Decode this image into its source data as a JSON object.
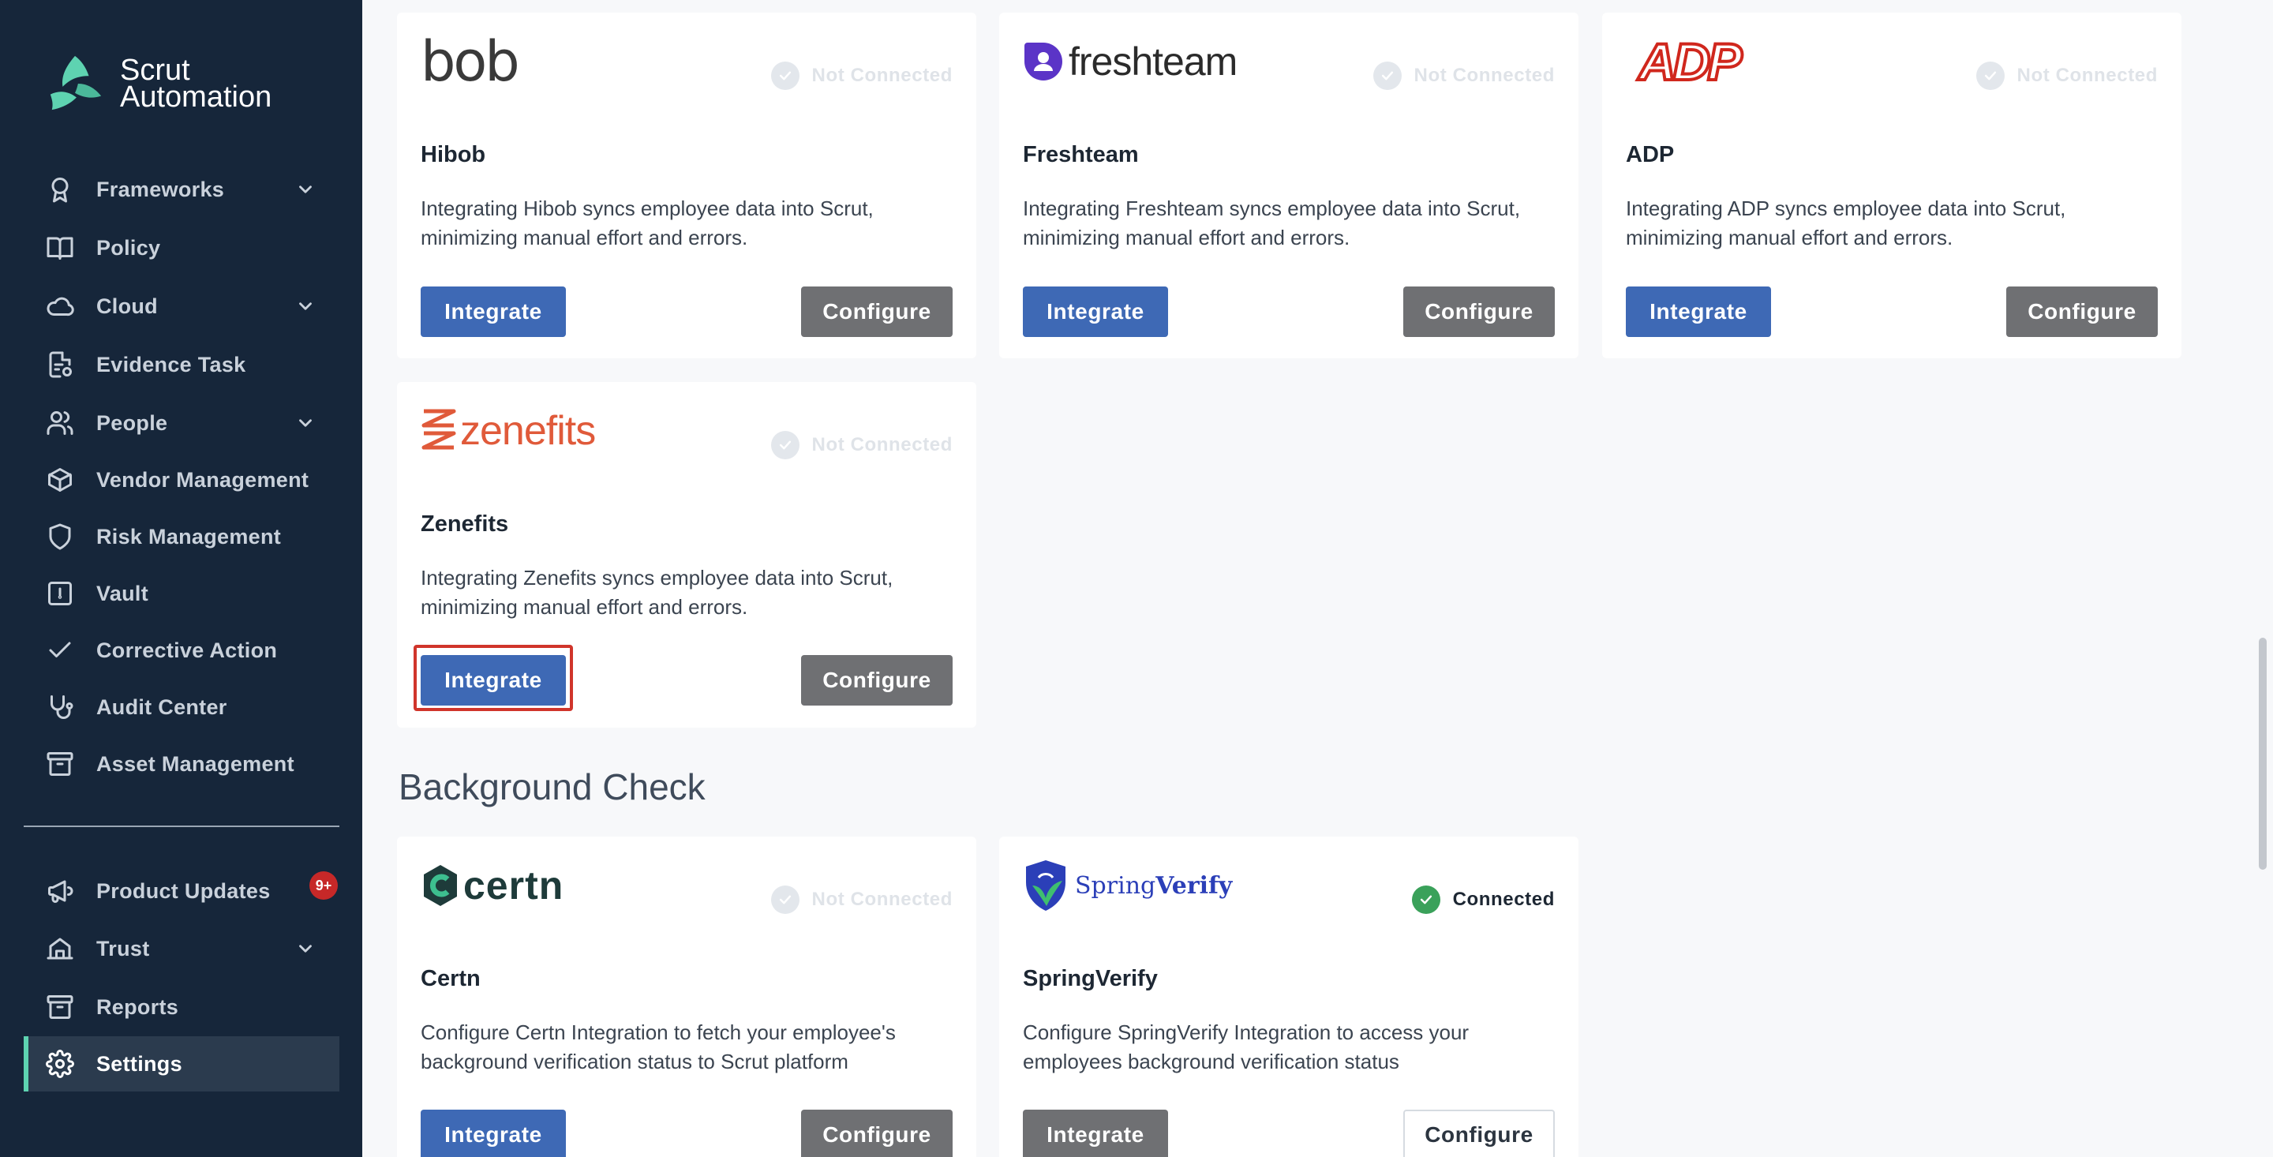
{
  "brand": {
    "line1": "Scrut",
    "line2": "Automation"
  },
  "sidebar": {
    "items": [
      {
        "label": "Frameworks",
        "icon": "award-icon",
        "chevron": true
      },
      {
        "label": "Policy",
        "icon": "book-icon",
        "chevron": false
      },
      {
        "label": "Cloud",
        "icon": "cloud-icon",
        "chevron": true
      },
      {
        "label": "Evidence Task",
        "icon": "file-check-icon",
        "chevron": false
      },
      {
        "label": "People",
        "icon": "users-icon",
        "chevron": true
      },
      {
        "label": "Vendor Management",
        "icon": "box-icon",
        "chevron": false
      },
      {
        "label": "Risk Management",
        "icon": "shield-icon",
        "chevron": false
      },
      {
        "label": "Vault",
        "icon": "vault-icon",
        "chevron": false
      },
      {
        "label": "Corrective Action",
        "icon": "check-icon",
        "chevron": false
      },
      {
        "label": "Audit Center",
        "icon": "stethoscope-icon",
        "chevron": false
      },
      {
        "label": "Asset Management",
        "icon": "archive-icon",
        "chevron": false
      }
    ],
    "bottom_items": [
      {
        "label": "Product Updates",
        "icon": "megaphone-icon",
        "badge": "9+"
      },
      {
        "label": "Trust",
        "icon": "trust-icon",
        "chevron": true
      },
      {
        "label": "Reports",
        "icon": "reports-icon"
      },
      {
        "label": "Settings",
        "icon": "gear-icon",
        "active": true
      }
    ]
  },
  "cards": {
    "hibob": {
      "logo_text": "bob",
      "name": "Hibob",
      "status": "Not Connected",
      "desc_line1": "Integrating Hibob syncs employee data into Scrut,",
      "desc_line2": "minimizing manual effort and errors.",
      "integrate": "Integrate",
      "configure": "Configure"
    },
    "freshteam": {
      "logo_text": "freshteam",
      "name": "Freshteam",
      "status": "Not Connected",
      "desc_line1": "Integrating Freshteam syncs employee data into Scrut,",
      "desc_line2": "minimizing manual effort and errors.",
      "integrate": "Integrate",
      "configure": "Configure"
    },
    "adp": {
      "logo_text": "ADP",
      "name": "ADP",
      "status": "Not Connected",
      "desc_line1": "Integrating ADP syncs employee data into Scrut,",
      "desc_line2": "minimizing manual effort and errors.",
      "integrate": "Integrate",
      "configure": "Configure"
    },
    "zenefits": {
      "logo_text": "zenefits",
      "name": "Zenefits",
      "status": "Not Connected",
      "desc_line1": "Integrating Zenefits syncs employee data into Scrut,",
      "desc_line2": "minimizing manual effort and errors.",
      "integrate": "Integrate",
      "configure": "Configure"
    },
    "certn": {
      "logo_text": "certn",
      "name": "Certn",
      "status": "Not Connected",
      "desc_line1": "Configure Certn Integration to fetch your employee's",
      "desc_line2": "background verification status to Scrut platform",
      "integrate": "Integrate",
      "configure": "Configure"
    },
    "springverify": {
      "logo_text_a": "Spring",
      "logo_text_b": "Verify",
      "name": "SpringVerify",
      "status": "Connected",
      "desc_line1": "Configure SpringVerify Integration to access your",
      "desc_line2": "employees background verification status",
      "integrate": "Integrate",
      "configure": "Configure"
    }
  },
  "sections": {
    "background_check": "Background Check"
  },
  "colors": {
    "sidebar_bg": "#16263a",
    "accent": "#5ed3b1",
    "primary_button": "#3e69b5",
    "secondary_button": "#6f7073",
    "connected": "#3aa15a",
    "highlight": "#d0352b"
  }
}
